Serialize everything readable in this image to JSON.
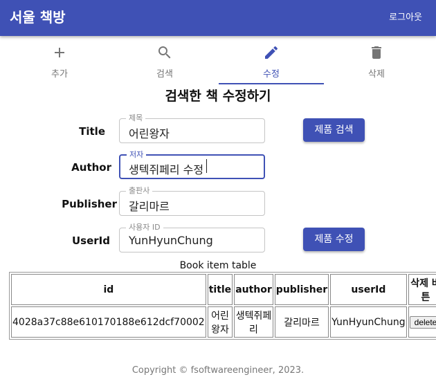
{
  "appbar": {
    "title": "서울 책방",
    "logout_label": "로그아웃"
  },
  "nav": {
    "tabs": [
      {
        "label": "추가",
        "icon": "plus-icon"
      },
      {
        "label": "검색",
        "icon": "search-icon"
      },
      {
        "label": "수정",
        "icon": "edit-icon",
        "active": true
      },
      {
        "label": "삭제",
        "icon": "trash-icon"
      }
    ]
  },
  "form": {
    "heading": "검색한 책 수정하기",
    "title": {
      "label": "Title",
      "legend": "제목",
      "value": "어린왕자"
    },
    "author": {
      "label": "Author",
      "legend": "저자",
      "value": "생텍쥐페리 수정"
    },
    "publisher": {
      "label": "Publisher",
      "legend": "출판사",
      "value": "갈리마르"
    },
    "userid": {
      "label": "UserId",
      "legend": "사용자 ID",
      "value": "YunHyunChung"
    },
    "search_button": "제품 검색",
    "update_button": "제품 수정"
  },
  "table": {
    "caption": "Book item table",
    "headers": [
      "id",
      "title",
      "author",
      "publisher",
      "userId",
      "삭제 버튼"
    ],
    "rows": [
      {
        "id": "4028a37c88e610170188e612dcf70002",
        "title": "어린왕자",
        "author": "생텍쥐페리",
        "publisher": "갈리마르",
        "userId": "YunHyunChung",
        "action": "delete"
      }
    ]
  },
  "footer": {
    "text": "Copyright © fsoftwareengineer, 2023."
  },
  "colors": {
    "primary": "#3f51b5",
    "inactive_tab": "#757575"
  }
}
